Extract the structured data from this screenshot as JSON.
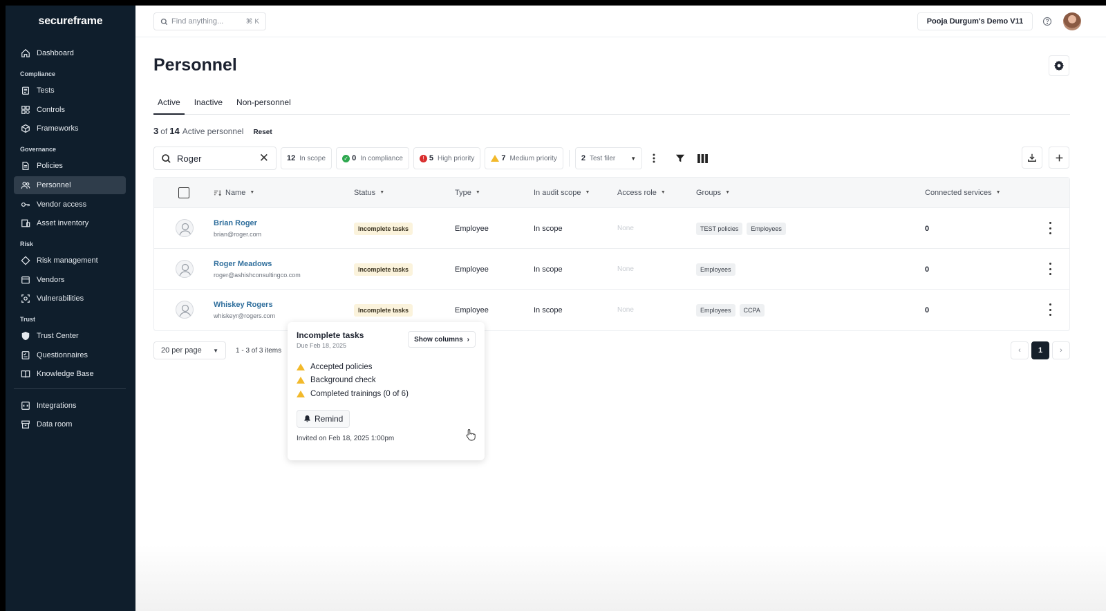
{
  "brand": "secureframe",
  "sidebar": {
    "items": {
      "dashboard": "Dashboard",
      "tests": "Tests",
      "controls": "Controls",
      "frameworks": "Frameworks",
      "policies": "Policies",
      "personnel": "Personnel",
      "vendor_access": "Vendor access",
      "asset_inventory": "Asset inventory",
      "risk_management": "Risk management",
      "vendors": "Vendors",
      "vulnerabilities": "Vulnerabilities",
      "trust_center": "Trust Center",
      "questionnaires": "Questionnaires",
      "knowledge_base": "Knowledge Base",
      "integrations": "Integrations",
      "data_room": "Data room"
    },
    "sections": {
      "compliance": "Compliance",
      "governance": "Governance",
      "risk": "Risk",
      "trust": "Trust"
    },
    "active": "personnel"
  },
  "topbar": {
    "search_placeholder": "Find anything...",
    "search_shortcut": "⌘ K",
    "org_name": "Pooja Durgum's Demo V11"
  },
  "page": {
    "title": "Personnel",
    "tabs": [
      "Active",
      "Inactive",
      "Non-personnel"
    ],
    "active_tab": "Active",
    "count_shown": "3",
    "count_of": "of",
    "count_total": "14",
    "count_label": "Active personnel",
    "reset_label": "Reset"
  },
  "filters": {
    "search_value": "Roger",
    "in_scope": {
      "count": "12",
      "label": "In scope"
    },
    "in_compliance": {
      "count": "0",
      "label": "In compliance"
    },
    "high_priority": {
      "count": "5",
      "label": "High priority"
    },
    "medium_priority": {
      "count": "7",
      "label": "Medium priority"
    },
    "test_filter": {
      "count": "2",
      "label": "Test filer"
    }
  },
  "table": {
    "columns": {
      "name": "Name",
      "status": "Status",
      "type": "Type",
      "in_audit_scope": "In audit scope",
      "access_role": "Access role",
      "groups": "Groups",
      "connected_services": "Connected services"
    },
    "rows": [
      {
        "name": "Brian Roger",
        "email": "brian@roger.com",
        "status": "Incomplete tasks",
        "type": "Employee",
        "scope": "In scope",
        "access_role": "None",
        "groups": [
          "TEST policies",
          "Employees"
        ],
        "connected": "0"
      },
      {
        "name": "Roger Meadows",
        "email": "roger@ashishconsultingco.com",
        "status": "Incomplete tasks",
        "type": "Employee",
        "scope": "In scope",
        "access_role": "None",
        "groups": [
          "Employees"
        ],
        "connected": "0"
      },
      {
        "name": "Whiskey Rogers",
        "email": "whiskeyr@rogers.com",
        "status": "Incomplete tasks",
        "type": "Employee",
        "scope": "In scope",
        "access_role": "None",
        "groups": [
          "Employees",
          "CCPA"
        ],
        "connected": "0"
      }
    ]
  },
  "pagination": {
    "per_page": "20 per page",
    "range": "1 - 3 of 3 items",
    "prev": "‹",
    "current": "1",
    "next": "›"
  },
  "popover": {
    "title": "Incomplete tasks",
    "due": "Due Feb 18, 2025",
    "show_columns": "Show columns",
    "tasks": [
      "Accepted policies",
      "Background check",
      "Completed trainings (0 of 6)"
    ],
    "remind_label": "Remind",
    "invited": "Invited on Feb 18, 2025 1:00pm"
  },
  "colors": {
    "sidebar_bg": "#0f1e2c",
    "sidebar_active": "#2f3d4b",
    "link": "#2f6e9c",
    "warning": "#f2b92b",
    "danger": "#d92d2d",
    "success": "#2ea84f",
    "status_badge_bg": "#fbf3dc"
  }
}
